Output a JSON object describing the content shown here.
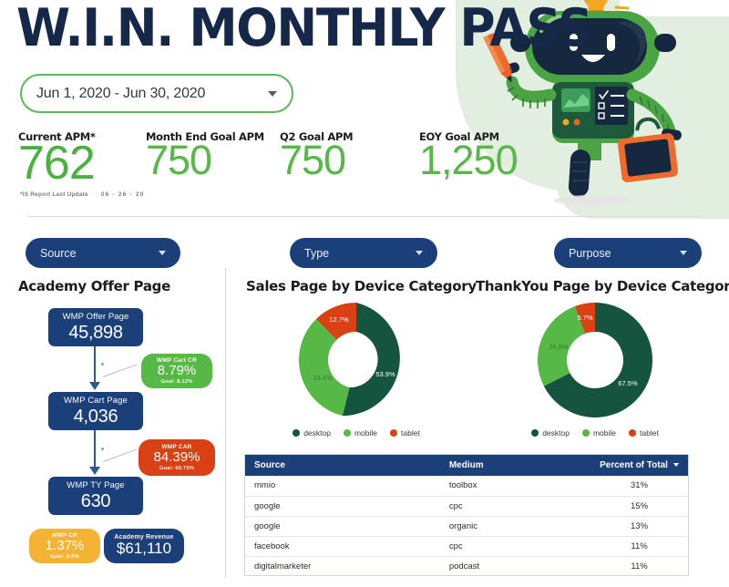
{
  "header": {
    "title": "W.I.N. MONTHLY PASS",
    "date_range": "Jun 1, 2020 - Jun 30, 2020",
    "footnote_label": "*IS Report Last Update",
    "footnote_date": "06 - 26 - 20"
  },
  "kpis": [
    {
      "label": "Current APM*",
      "value": "762"
    },
    {
      "label": "Month End Goal APM",
      "value": "750"
    },
    {
      "label": "Q2 Goal APM",
      "value": "750"
    },
    {
      "label": "EOY Goal APM",
      "value": "1,250"
    }
  ],
  "filters": [
    {
      "label": "Source"
    },
    {
      "label": "Type"
    },
    {
      "label": "Purpose"
    }
  ],
  "panels": {
    "funnel_title": "Academy Offer Page",
    "donut1_title": "Sales Page by Device Category",
    "donut2_title": "ThankYou Page by Device Category"
  },
  "funnel": {
    "steps": [
      {
        "name": "WMP Offer Page",
        "value": "45,898"
      },
      {
        "name": "WMP Cart Page",
        "value": "4,036"
      },
      {
        "name": "WMP TY Page",
        "value": "630"
      }
    ],
    "badges": [
      {
        "name": "WMP Cart CR",
        "value": "8.79%",
        "goal": "Goal: 8.12%",
        "color": "#56b845"
      },
      {
        "name": "WMP CAR",
        "value": "84.39%",
        "goal": "Goal: 60.75%",
        "color": "#d94115"
      },
      {
        "name": "WMP CR",
        "value": "1.37%",
        "goal": "Goal: 2-5%",
        "color": "#f5b335"
      },
      {
        "name": "Academy Revenue",
        "value": "$61,110",
        "goal": "",
        "color": "#1b4079"
      }
    ]
  },
  "table": {
    "columns": [
      "Source",
      "Medium",
      "Percent of Total"
    ],
    "sorted_column": "Percent of Total",
    "rows": [
      {
        "source": "mmio",
        "medium": "toolbox",
        "percent": "31%"
      },
      {
        "source": "google",
        "medium": "cpc",
        "percent": "15%"
      },
      {
        "source": "google",
        "medium": "organic",
        "percent": "13%"
      },
      {
        "source": "facebook",
        "medium": "cpc",
        "percent": "11%"
      },
      {
        "source": "digitalmarketer",
        "medium": "podcast",
        "percent": "11%"
      }
    ]
  },
  "colors": {
    "navy": "#1b4079",
    "green": "#56b845",
    "dark_green": "#15543f",
    "red": "#d94115",
    "orange": "#f5b335",
    "title_navy": "#16284a"
  },
  "chart_data": [
    {
      "type": "pie",
      "title": "Sales Page by Device Category",
      "categories": [
        "desktop",
        "mobile",
        "tablet"
      ],
      "values": [
        53.9,
        33.4,
        12.7
      ],
      "labels": [
        "53.9%",
        "33.4%",
        "12.7%"
      ],
      "colors": [
        "#15543f",
        "#56b845",
        "#d94115"
      ],
      "legend_position": "bottom",
      "donut": true
    },
    {
      "type": "pie",
      "title": "ThankYou Page by Device Category",
      "categories": [
        "desktop",
        "mobile",
        "tablet"
      ],
      "values": [
        67.5,
        26.8,
        5.7
      ],
      "labels": [
        "67.5%",
        "26.8%",
        "5.7%"
      ],
      "colors": [
        "#15543f",
        "#56b845",
        "#d94115"
      ],
      "legend_position": "bottom",
      "donut": true
    }
  ]
}
